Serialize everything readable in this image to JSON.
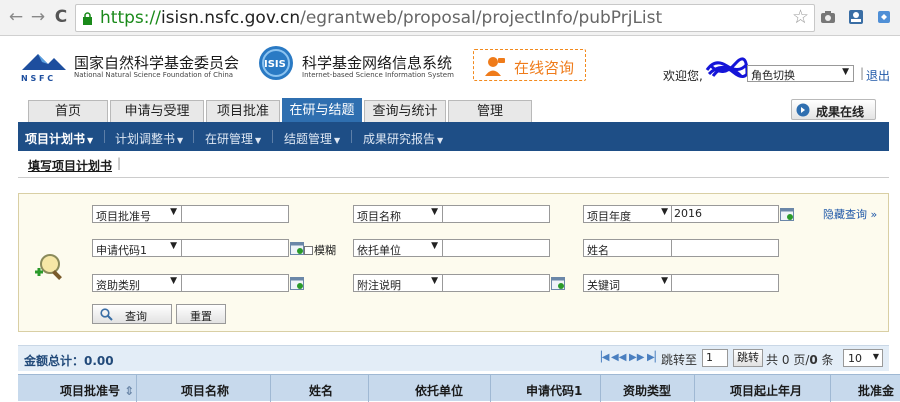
{
  "browser": {
    "url_scheme": "https://",
    "url_host": "isisn.nsfc.gov.cn",
    "url_path": "/egrantweb/proposal/projectInfo/pubPrjList"
  },
  "header": {
    "org_name_cn": "国家自然科学基金委员会",
    "org_name_en": "National Natural Science Foundation of China",
    "system_name_cn": "科学基金网络信息系统",
    "system_name_en": "Internet-based Science Information System",
    "consult_label": "在线咨询",
    "welcome_text": "欢迎您,",
    "role_switch": "角色切换",
    "separator": "|",
    "logout_label": "退出"
  },
  "main_tabs": [
    {
      "label": "首页",
      "active": false
    },
    {
      "label": "申请与受理",
      "active": false
    },
    {
      "label": "项目批准",
      "active": false
    },
    {
      "label": "在研与结题",
      "active": true
    },
    {
      "label": "查询与统计",
      "active": false
    },
    {
      "label": "管理",
      "active": false
    }
  ],
  "online_results_label": "成果在线",
  "sub_nav": [
    {
      "label": "项目计划书",
      "active": true
    },
    {
      "label": "计划调整书",
      "active": false
    },
    {
      "label": "在研管理",
      "active": false
    },
    {
      "label": "结题管理",
      "active": false
    },
    {
      "label": "成果研究报告",
      "active": false
    }
  ],
  "breadcrumb": {
    "label": "填写项目计划书",
    "separator": "|"
  },
  "search": {
    "hide_label": "隐藏查询",
    "row1": {
      "field1": "项目批准号",
      "value1": "",
      "field2": "项目名称",
      "value2": "",
      "field3": "项目年度",
      "value3": "2016"
    },
    "row2": {
      "field1": "申请代码1",
      "value1": "",
      "fuzzy_label": "模糊",
      "field2": "依托单位",
      "value2": "",
      "field3": "姓名",
      "value3": ""
    },
    "row3": {
      "field1": "资助类别",
      "value1": "",
      "field2": "附注说明",
      "value2": "",
      "field3": "关键词",
      "value3": ""
    },
    "query_label": "查询",
    "reset_label": "重置"
  },
  "results": {
    "total_label": "金额总计：",
    "total_value": "0.00",
    "jump_to": "跳转至",
    "page_value": "1",
    "jump_button": "跳转",
    "page_info_prefix": "共",
    "page_info_pages": "0",
    "page_info_mid": "页/",
    "page_info_count": "0",
    "page_info_suffix": "条",
    "page_size": "10"
  },
  "table_headers": [
    "项目批准号",
    "项目名称",
    "姓名",
    "依托单位",
    "申请代码1",
    "资助类型",
    "项目起止年月",
    "批准金"
  ],
  "colors": {
    "tab_active": "#2f6fb0",
    "subnav_bg": "#1e4e86",
    "search_bg": "#fdfbee",
    "consult_orange": "#ef7b1a",
    "table_header_bg": "#c7d9ec"
  }
}
